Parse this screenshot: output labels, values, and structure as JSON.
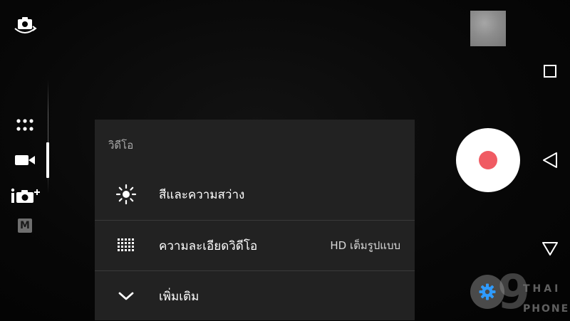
{
  "menu": {
    "title": "วิดีโอ",
    "rows": [
      {
        "icon": "brightness-icon",
        "label": "สีและความสว่าง",
        "value": ""
      },
      {
        "icon": "resolution-grid-icon",
        "label": "ความละเอียดวิดีโอ",
        "value": "HD เต็มรูปแบบ"
      },
      {
        "icon": "chevron-down-icon",
        "label": "เพิ่มเติม",
        "value": ""
      }
    ]
  },
  "left_rail": {
    "top_icon": "switch-camera-icon",
    "modes": [
      "app-grid-icon",
      "video-camera-icon",
      "photo-plus-icon",
      "manual-mode-icon"
    ],
    "manual_badge": "M",
    "active_mode": "video-camera-icon"
  },
  "right_panel": {
    "thumbnail": "last-capture-thumbnail",
    "shutter": "record-button",
    "settings_icon": "gear-icon"
  },
  "nav": [
    "recent-apps-icon",
    "back-icon",
    "home-icon"
  ],
  "watermark": {
    "number": "9",
    "line1": "THAI",
    "line2": "PHONE"
  },
  "colors": {
    "background": "#050505",
    "menu_bg": "#222222",
    "record_dot": "#f05b63",
    "settings_gear": "#2f9bff",
    "divider": "#3a3a3a"
  }
}
